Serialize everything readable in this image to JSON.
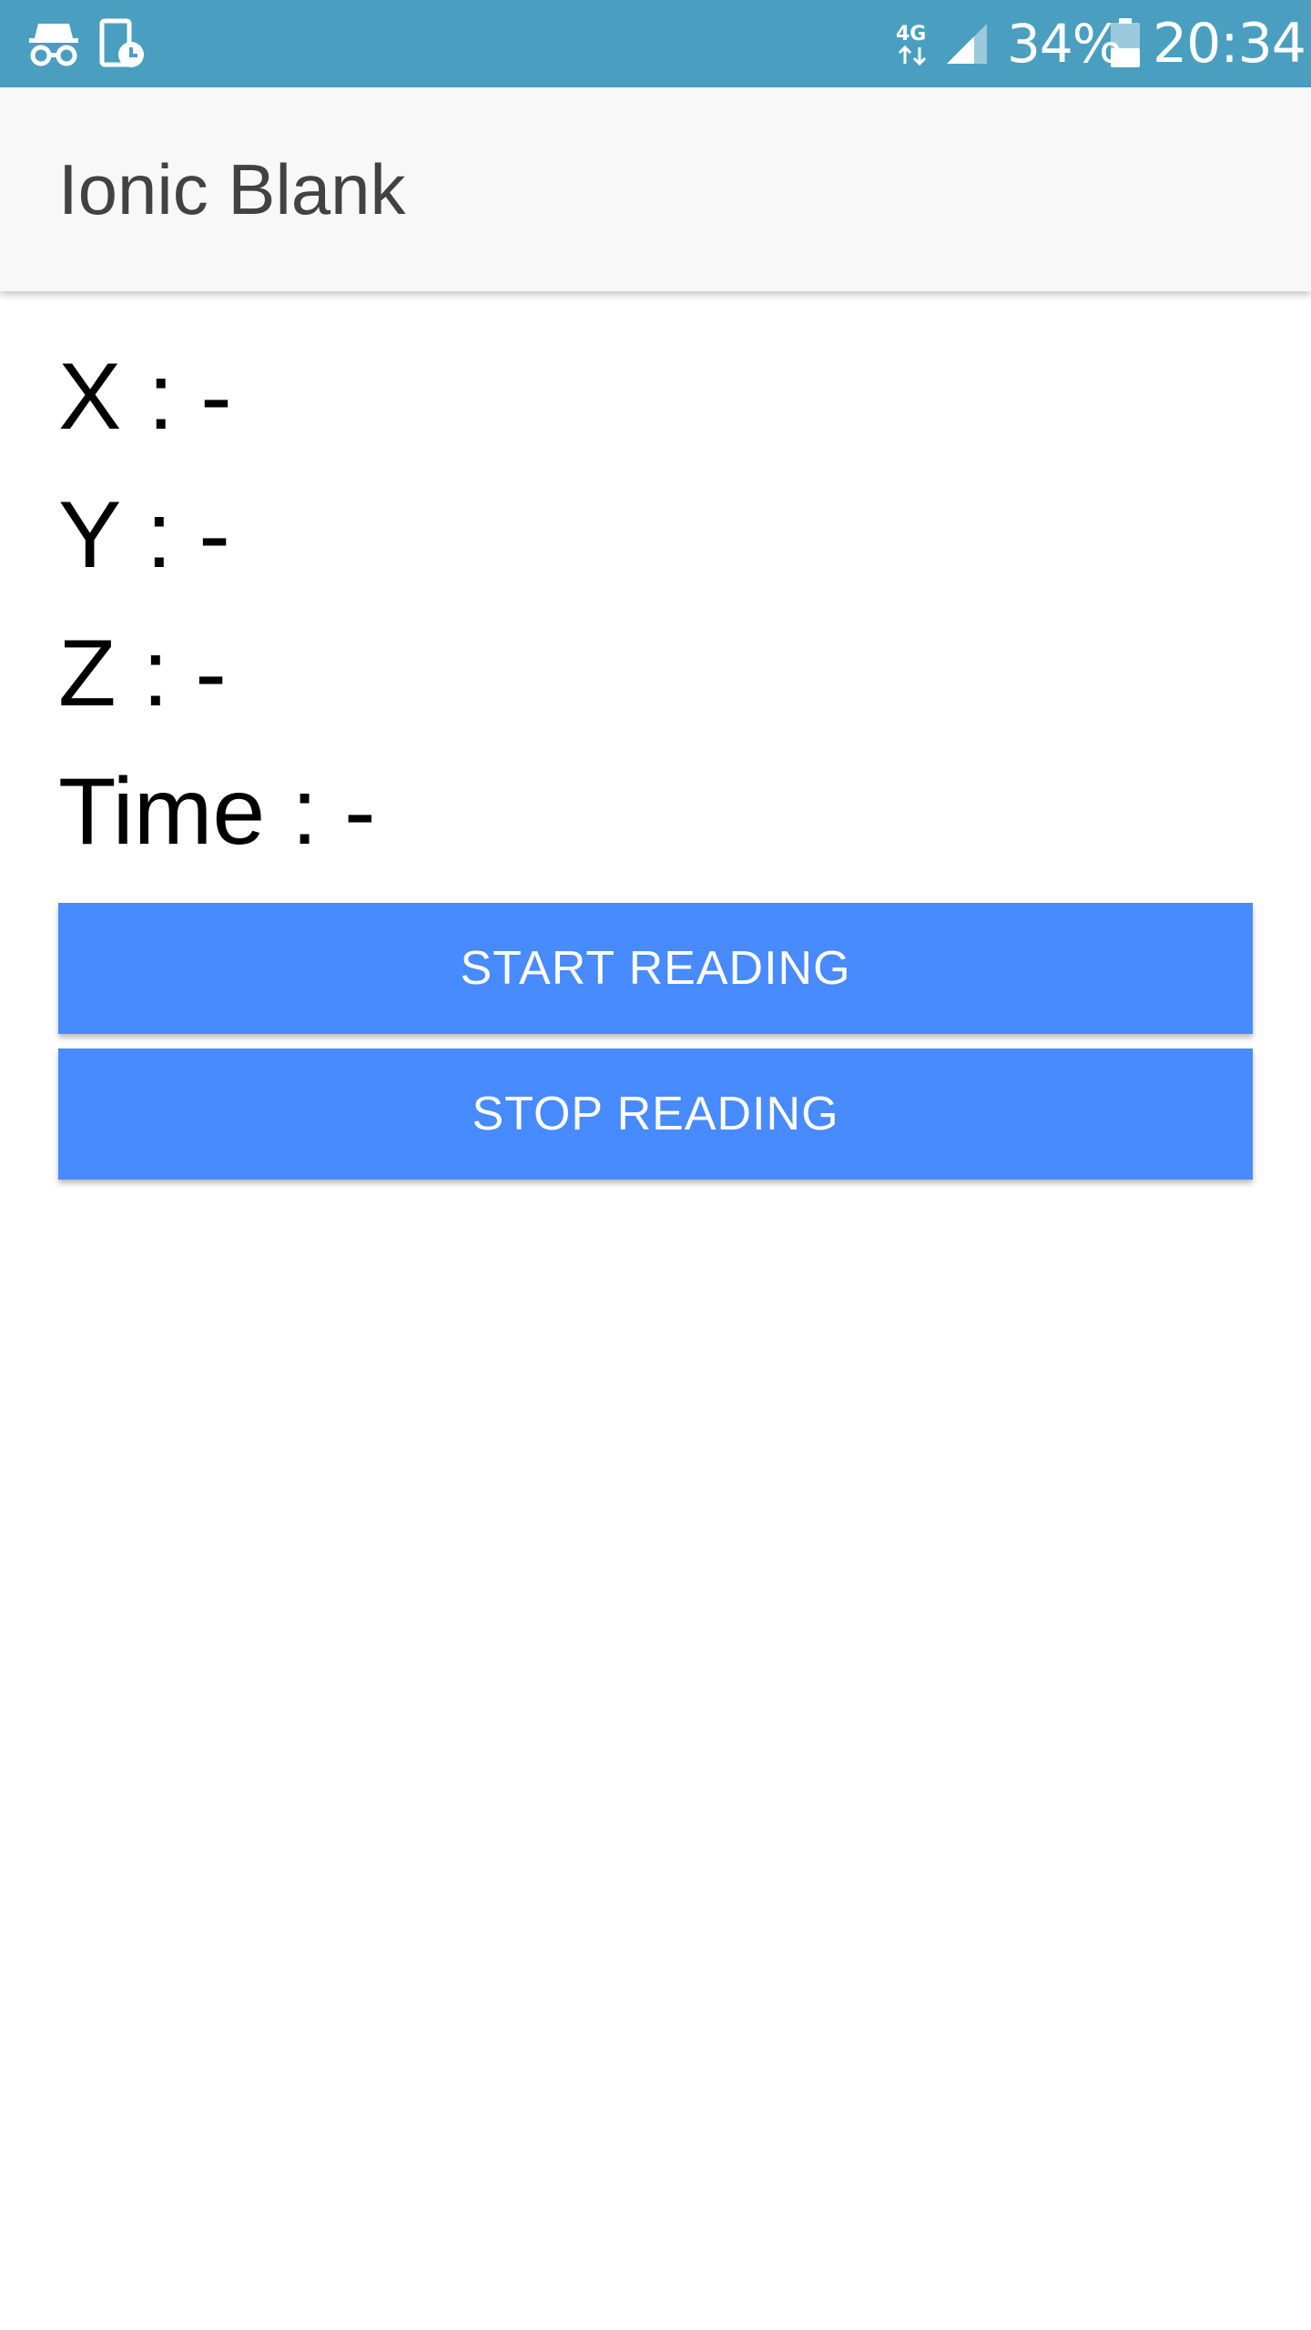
{
  "status_bar": {
    "icons_left": [
      "incognito-icon",
      "screen-timer-icon"
    ],
    "network_type": "4G",
    "battery_percent": "34%",
    "time": "20:34",
    "background_color": "#4a9fc0"
  },
  "header": {
    "title": "Ionic Blank",
    "background_color": "#f8f8f8"
  },
  "readings": [
    {
      "label": "X",
      "separator": " : ",
      "value": "-"
    },
    {
      "label": "Y",
      "separator": " : ",
      "value": "-"
    },
    {
      "label": "Z",
      "separator": " : ",
      "value": "-"
    },
    {
      "label": "Time",
      "separator": " : ",
      "value": "-"
    }
  ],
  "buttons": {
    "start_label": "START READING",
    "stop_label": "STOP READING",
    "color": "#488aff"
  }
}
